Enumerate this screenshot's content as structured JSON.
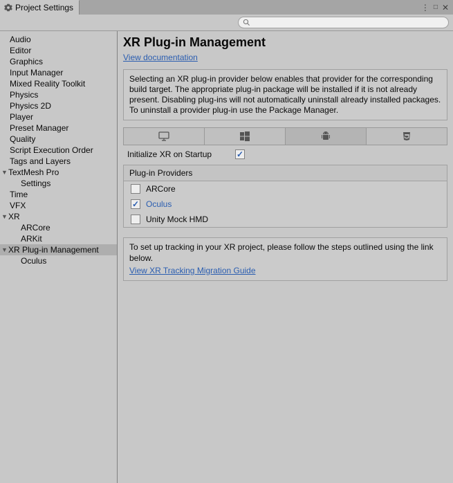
{
  "window": {
    "title": "Project Settings"
  },
  "search": {
    "placeholder": ""
  },
  "sidebar": {
    "items": [
      {
        "label": "Audio",
        "level": 0
      },
      {
        "label": "Editor",
        "level": 0
      },
      {
        "label": "Graphics",
        "level": 0
      },
      {
        "label": "Input Manager",
        "level": 0
      },
      {
        "label": "Mixed Reality Toolkit",
        "level": 0
      },
      {
        "label": "Physics",
        "level": 0
      },
      {
        "label": "Physics 2D",
        "level": 0
      },
      {
        "label": "Player",
        "level": 0
      },
      {
        "label": "Preset Manager",
        "level": 0
      },
      {
        "label": "Quality",
        "level": 0
      },
      {
        "label": "Script Execution Order",
        "level": 0
      },
      {
        "label": "Tags and Layers",
        "level": 0
      },
      {
        "label": "TextMesh Pro",
        "level": 0,
        "expanded": true
      },
      {
        "label": "Settings",
        "level": 1
      },
      {
        "label": "Time",
        "level": 0
      },
      {
        "label": "VFX",
        "level": 0
      },
      {
        "label": "XR",
        "level": 0,
        "expanded": true
      },
      {
        "label": "ARCore",
        "level": 1
      },
      {
        "label": "ARKit",
        "level": 1
      },
      {
        "label": "XR Plug-in Management",
        "level": 0,
        "expanded": true,
        "selected": true
      },
      {
        "label": "Oculus",
        "level": 1
      }
    ]
  },
  "main": {
    "heading": "XR Plug-in Management",
    "doc_link": "View documentation",
    "info": "Selecting an XR plug-in provider below enables that provider for the corresponding build target. The appropriate plug-in package will be installed if it is not already present. Disabling plug-ins will not automatically uninstall already installed packages. To uninstall a provider plug-in use the Package Manager.",
    "platform_tabs": [
      {
        "name": "standalone",
        "active": false
      },
      {
        "name": "windows",
        "active": false
      },
      {
        "name": "android",
        "active": true
      },
      {
        "name": "webgl",
        "active": false
      }
    ],
    "init_label": "Initialize XR on Startup",
    "init_checked": true,
    "providers_header": "Plug-in Providers",
    "providers": [
      {
        "label": "ARCore",
        "checked": false
      },
      {
        "label": "Oculus",
        "checked": true
      },
      {
        "label": "Unity Mock HMD",
        "checked": false
      }
    ],
    "tracking_text": "To set up tracking in your XR project, please follow the steps outlined using the link below.",
    "tracking_link": "View XR Tracking Migration Guide"
  }
}
